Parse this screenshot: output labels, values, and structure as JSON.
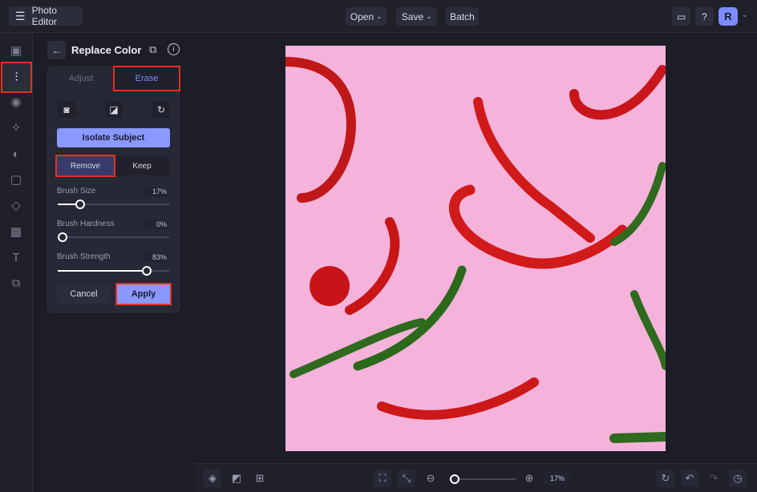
{
  "header": {
    "app_title": "Photo Editor",
    "open": "Open",
    "save": "Save",
    "batch": "Batch",
    "avatar": "R"
  },
  "panel": {
    "title": "Replace Color",
    "tabs": [
      "Adjust",
      "Erase"
    ],
    "isolate": "Isolate Subject",
    "remove": "Remove",
    "keep": "Keep",
    "sliders": [
      {
        "label": "Brush Size",
        "value": "17%",
        "fraction": 0.17
      },
      {
        "label": "Brush Hardness",
        "value": "0%",
        "fraction": 0
      },
      {
        "label": "Brush Strength",
        "value": "83%",
        "fraction": 0.83
      }
    ],
    "cancel": "Cancel",
    "apply": "Apply"
  },
  "bottom": {
    "zoom": "17%",
    "zoom_fraction": 0.02
  },
  "colors": {
    "accent": "#7c8cff",
    "highlight": "#e0321e",
    "photo_bg": "#f5b3dc"
  }
}
